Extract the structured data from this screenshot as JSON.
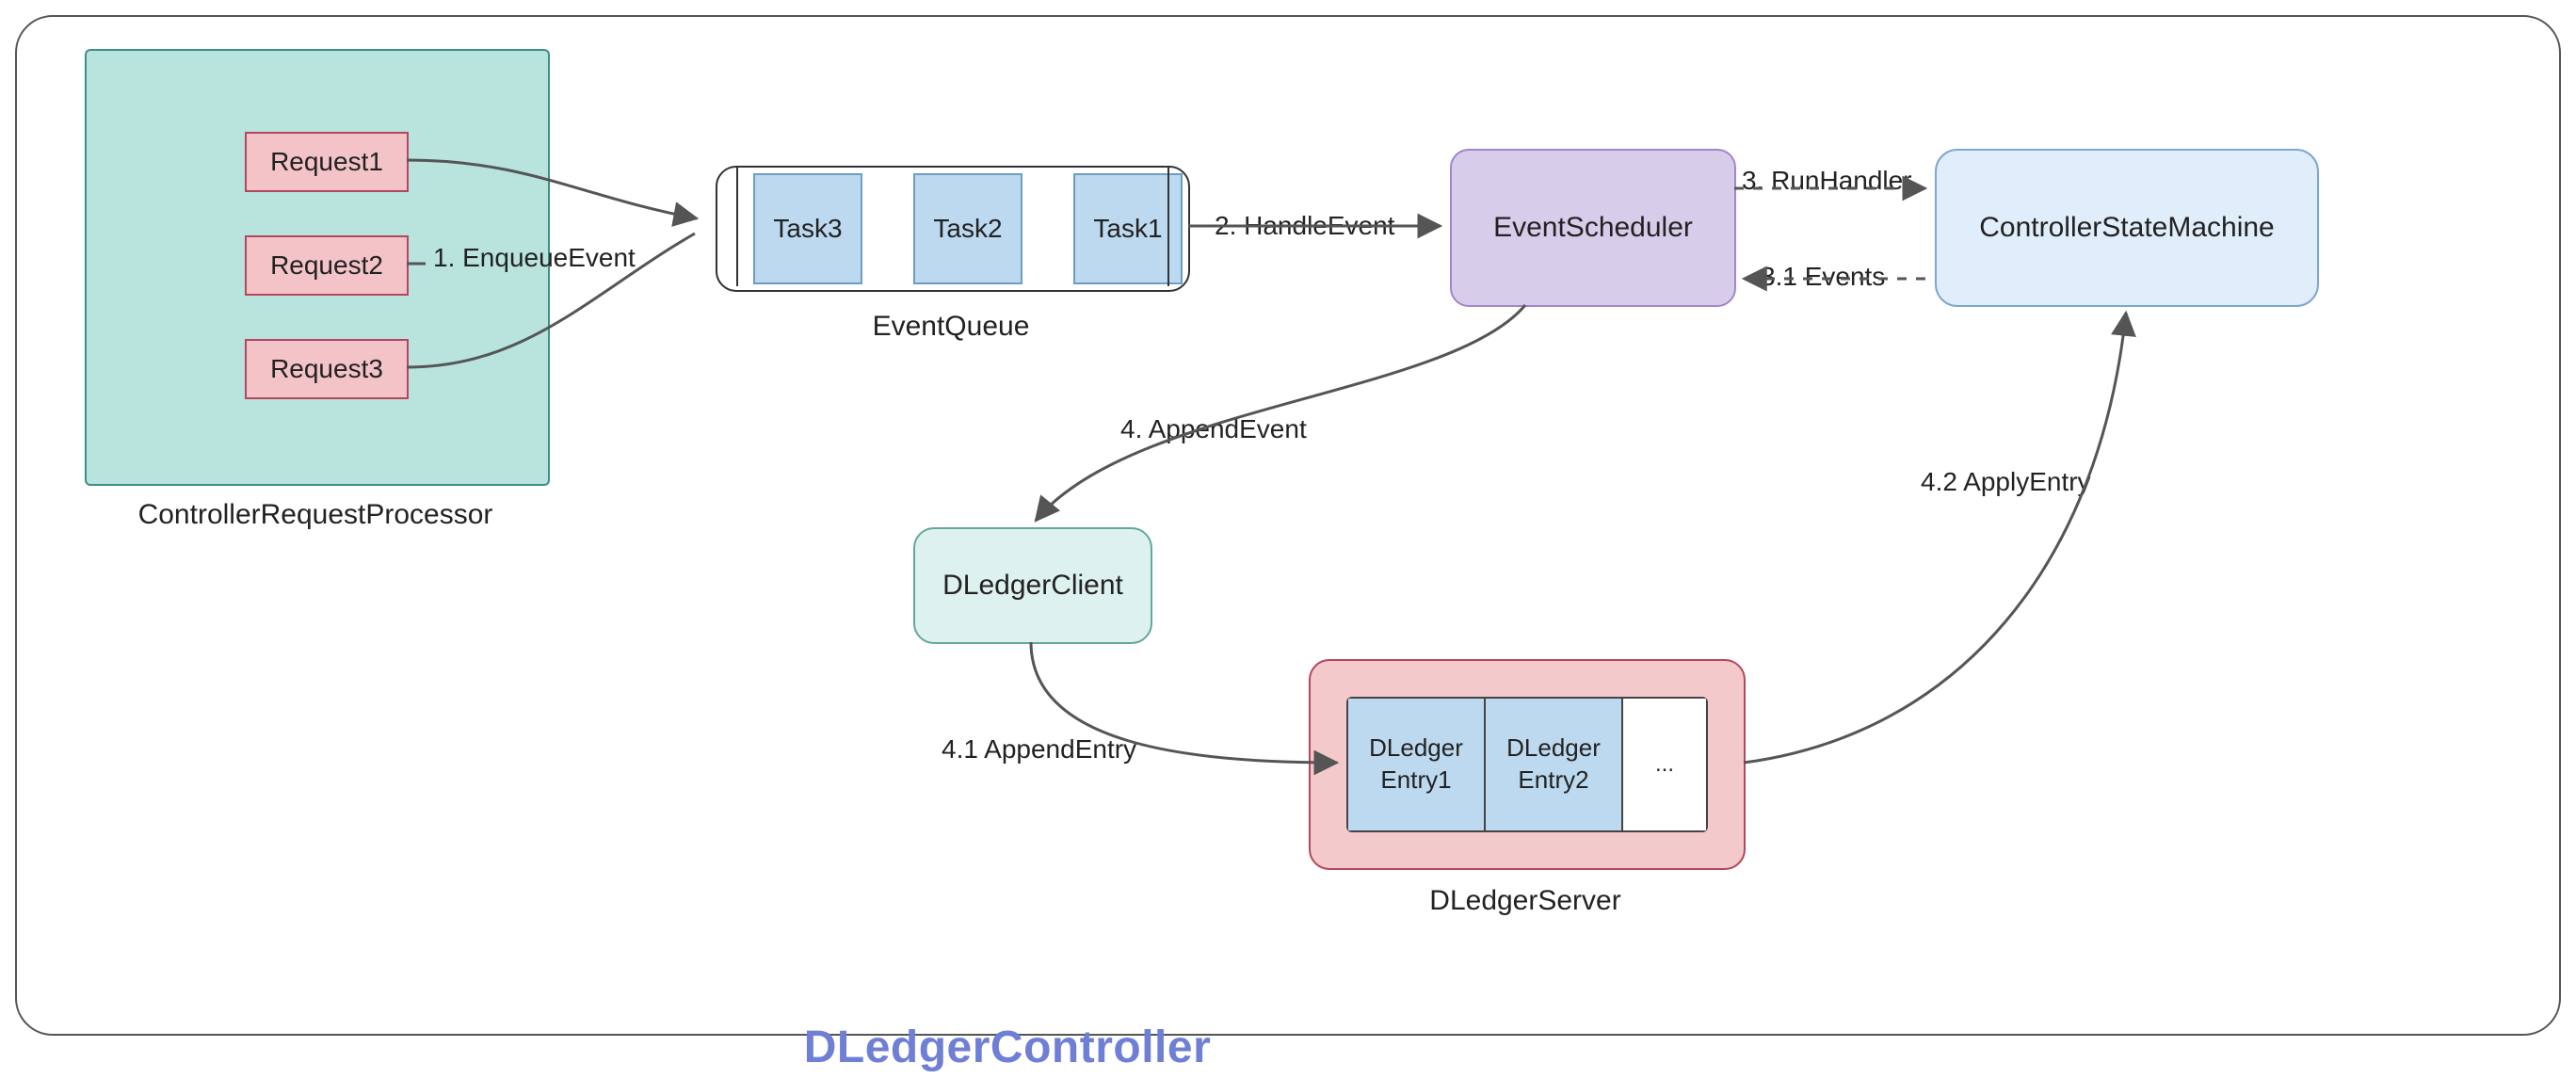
{
  "title": "DLedgerController",
  "processor": {
    "label": "ControllerRequestProcessor",
    "requests": [
      "Request1",
      "Request2",
      "Request3"
    ]
  },
  "queue": {
    "label": "EventQueue",
    "tasks": [
      "Task3",
      "Task2",
      "Task1"
    ]
  },
  "scheduler": {
    "label": "EventScheduler"
  },
  "stateMachine": {
    "label": "ControllerStateMachine"
  },
  "client": {
    "label": "DLedgerClient"
  },
  "server": {
    "label": "DLedgerServer",
    "entries": [
      "DLedger Entry1",
      "DLedger Entry2",
      "..."
    ]
  },
  "edges": {
    "e1": "1. EnqueueEvent",
    "e2": "2. HandleEvent",
    "e3": "3. RunHandler",
    "e31": "3.1 Events",
    "e4": "4. AppendEvent",
    "e41": "4.1 AppendEntry",
    "e42": "4.2 ApplyEntry"
  }
}
